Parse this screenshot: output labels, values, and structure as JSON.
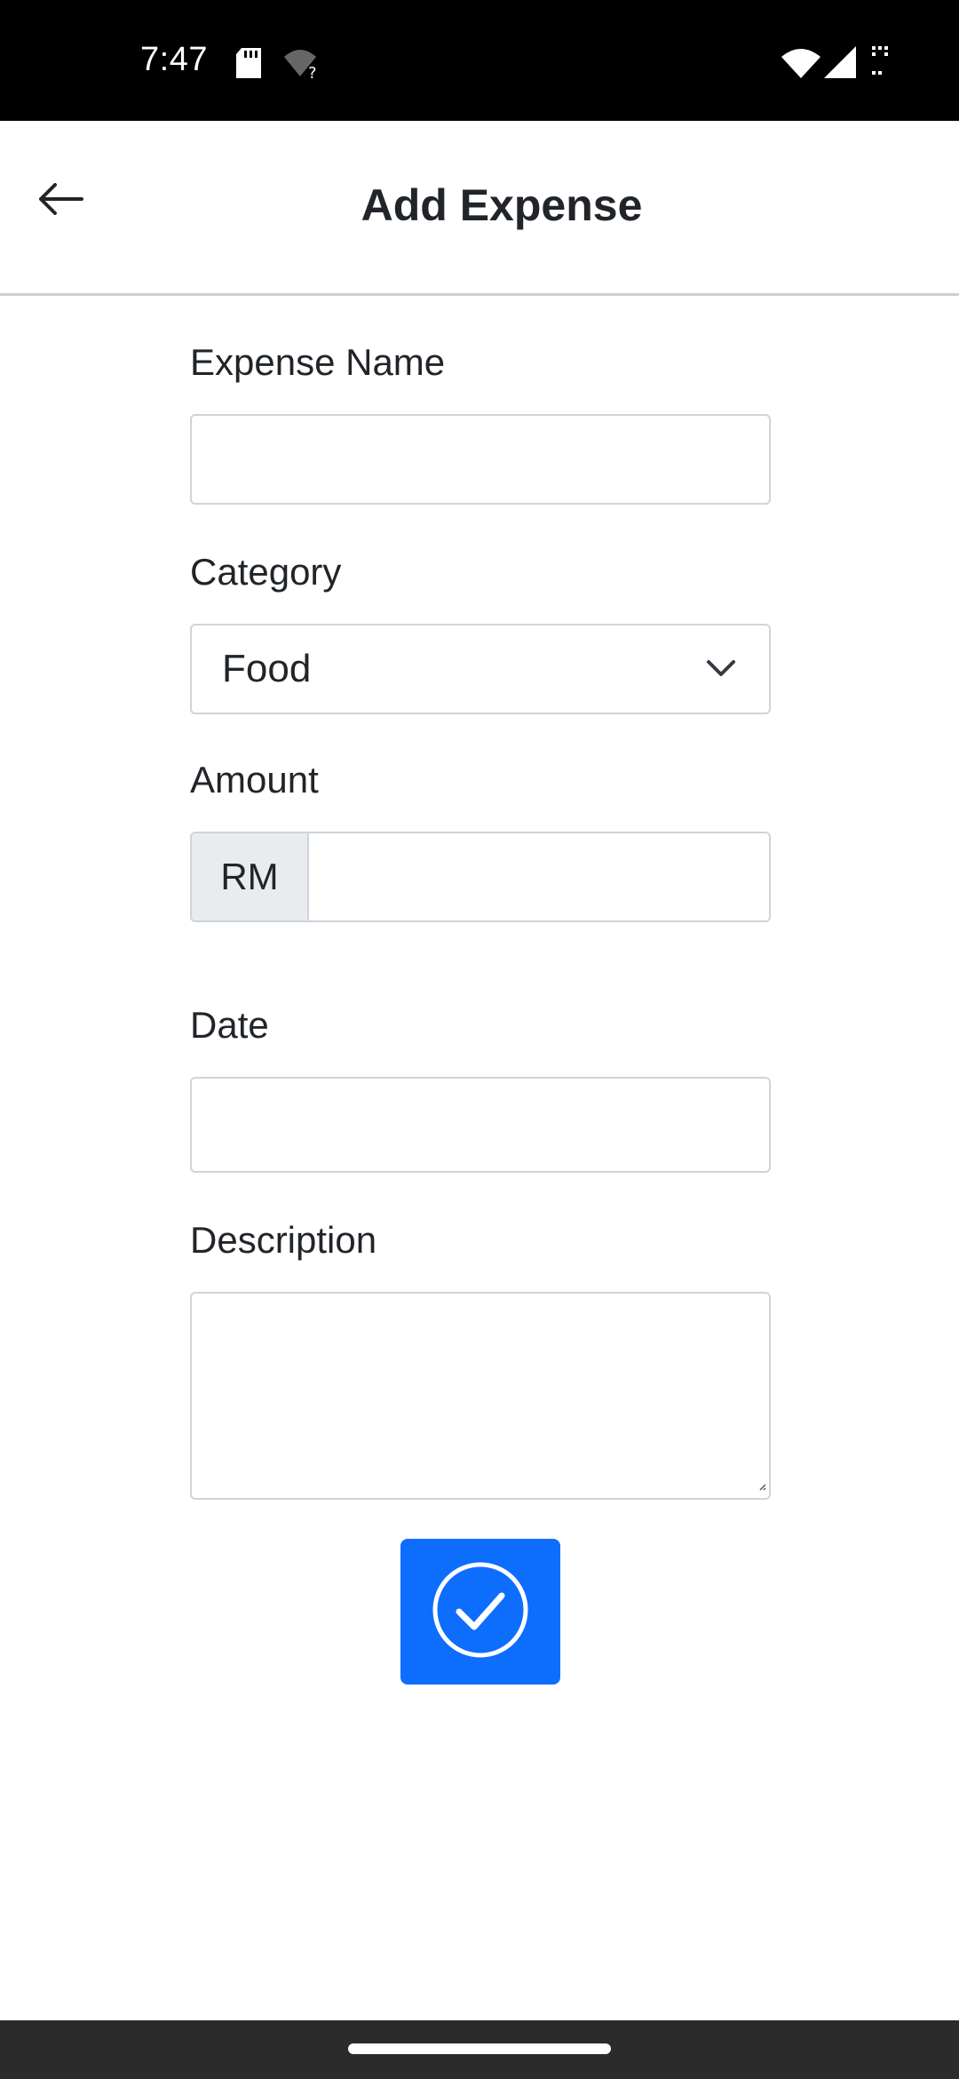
{
  "status_bar": {
    "time": "7:47",
    "left_icons": [
      "sd-card-icon",
      "wifi-question-icon"
    ],
    "right_icons": [
      "wifi-icon",
      "signal-icon",
      "battery-icon"
    ]
  },
  "header": {
    "back_icon": "arrow-left-icon",
    "title": "Add Expense"
  },
  "form": {
    "expense_name": {
      "label": "Expense Name",
      "value": ""
    },
    "category": {
      "label": "Category",
      "value": "Food",
      "icon": "chevron-down-icon"
    },
    "amount": {
      "label": "Amount",
      "prefix": "RM",
      "value": ""
    },
    "date": {
      "label": "Date",
      "value": ""
    },
    "description": {
      "label": "Description",
      "value": ""
    },
    "submit": {
      "icon": "check-circle-icon",
      "color": "#0d6efd"
    }
  },
  "colors": {
    "accent": "#0d6efd",
    "border": "#ced4da",
    "prefix_bg": "#e9ecef"
  }
}
